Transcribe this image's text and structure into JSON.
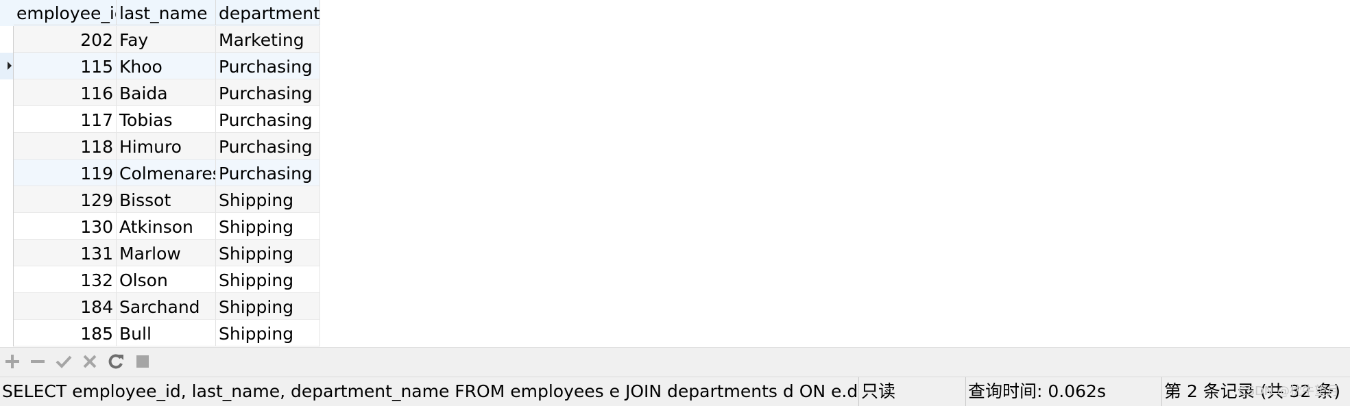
{
  "columns": [
    "employee_id",
    "last_name",
    "department_"
  ],
  "rows": [
    {
      "id": "202",
      "last_name": "Fay",
      "department": "Marketing"
    },
    {
      "id": "115",
      "last_name": "Khoo",
      "department": "Purchasing"
    },
    {
      "id": "116",
      "last_name": "Baida",
      "department": "Purchasing"
    },
    {
      "id": "117",
      "last_name": "Tobias",
      "department": "Purchasing"
    },
    {
      "id": "118",
      "last_name": "Himuro",
      "department": "Purchasing"
    },
    {
      "id": "119",
      "last_name": "Colmenares",
      "department": "Purchasing"
    },
    {
      "id": "129",
      "last_name": "Bissot",
      "department": "Shipping"
    },
    {
      "id": "130",
      "last_name": "Atkinson",
      "department": "Shipping"
    },
    {
      "id": "131",
      "last_name": "Marlow",
      "department": "Shipping"
    },
    {
      "id": "132",
      "last_name": "Olson",
      "department": "Shipping"
    },
    {
      "id": "184",
      "last_name": "Sarchand",
      "department": "Shipping"
    },
    {
      "id": "185",
      "last_name": "Bull",
      "department": "Shipping"
    }
  ],
  "toolbar": {
    "icons": [
      "plus-icon",
      "minus-icon",
      "check-icon",
      "close-icon",
      "refresh-icon",
      "stop-icon"
    ]
  },
  "status": {
    "query": "SELECT employee_id, last_name, department_name FROM employees e  JOIN departments d ON e.departme",
    "mode": "只读",
    "time": "查询时间: 0.062s",
    "record": "第 2 条记录 (共 32 条)",
    "watermark": "CSDN @枕牛望月"
  },
  "colors": {
    "header_bg": "#eef6fd",
    "selected_row_bg": "#e6f0fa",
    "alt_row_bg": "#f6f6f6",
    "status_bg": "#f0f0f0",
    "icon_gray": "#a5a5a5"
  }
}
